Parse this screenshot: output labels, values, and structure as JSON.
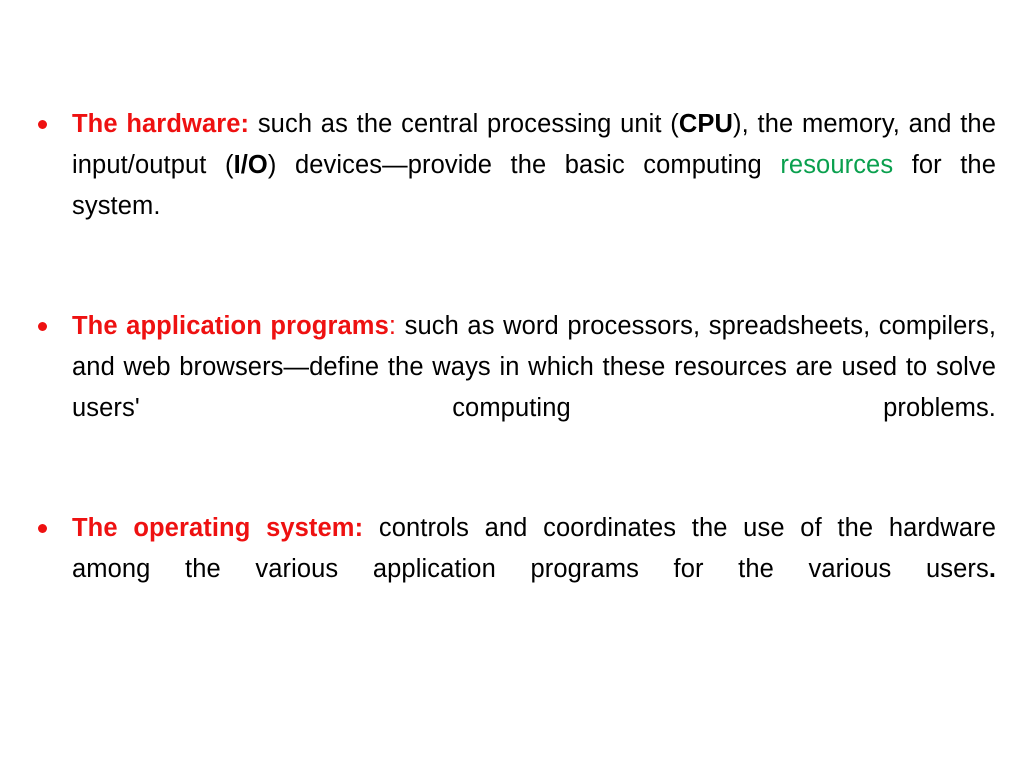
{
  "slide": {
    "background_color": "#ffffff",
    "accent_red": "#ee1111",
    "accent_green": "#0aa04e",
    "text_color": "#000000",
    "bullets": [
      {
        "id": "hardware",
        "marker": "round-bullet",
        "term": "The hardware",
        "term_colon": ":",
        "segments": {
          "part1": " such as the central processing unit (",
          "bold1": "CPU",
          "part2": "), the memory, and the input/output (",
          "bold2": "I/O",
          "part3": ") devices—provide the basic computing ",
          "green1": "resources",
          "part4": " for the system."
        },
        "plain_text": "The hardware: such as the central processing unit (CPU), the memory, and the input/output (I/O) devices—provide the basic computing resources for the system."
      },
      {
        "id": "application-programs",
        "marker": "round-bullet",
        "term": "The application programs",
        "term_colon": ":",
        "segments": {
          "part1": " such as word processors, spreadsheets, compilers, and web browsers—define the ways in which these resources are used to solve users' computing problems."
        },
        "plain_text": "The application programs: such as word processors, spreadsheets, compilers, and web browsers—define the ways in which these resources are used to solve users' computing problems."
      },
      {
        "id": "operating-system",
        "marker": "round-bullet",
        "term": "The operating system:",
        "term_colon": "",
        "segments": {
          "part1": " controls and coordinates the use of the hardware among the various application programs for the various users",
          "period": "."
        },
        "plain_text": "The operating system: controls and coordinates the use of the hardware among the various application programs for the various users."
      }
    ]
  }
}
